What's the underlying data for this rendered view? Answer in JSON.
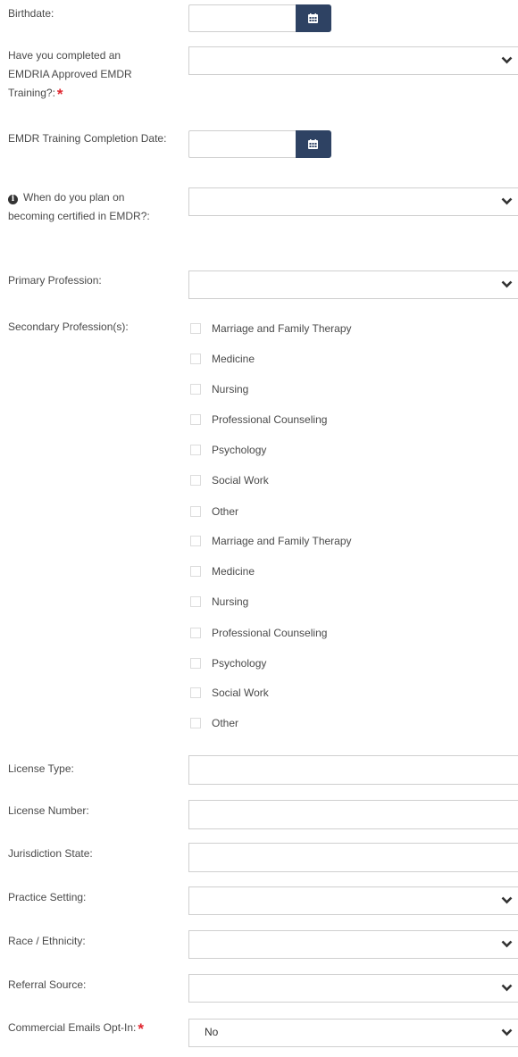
{
  "fields": {
    "birthdate": {
      "label": "Birthdate:"
    },
    "emdr_training": {
      "label": "Have you completed an EMDRIA Approved EMDR Training?:",
      "required_mark": "*",
      "value": ""
    },
    "training_completion": {
      "label": "EMDR Training Completion Date:"
    },
    "certified_plan": {
      "info_icon": "info-icon",
      "label": "When do you plan on becoming certified in EMDR?:",
      "value": ""
    },
    "primary_profession": {
      "label": "Primary Profession:",
      "value": ""
    },
    "secondary_profession": {
      "label": "Secondary Profession(s):",
      "options": [
        "Marriage and Family Therapy",
        "Medicine",
        "Nursing",
        "Professional Counseling",
        "Psychology",
        "Social Work",
        "Other",
        "Marriage and Family Therapy",
        "Medicine",
        "Nursing",
        "Professional Counseling",
        "Psychology",
        "Social Work",
        "Other"
      ]
    },
    "license_type": {
      "label": "License Type:",
      "value": ""
    },
    "license_number": {
      "label": "License Number:",
      "value": ""
    },
    "jurisdiction_state": {
      "label": "Jurisdiction State:",
      "value": ""
    },
    "practice_setting": {
      "label": "Practice Setting:",
      "value": ""
    },
    "race_ethnicity": {
      "label": "Race / Ethnicity:",
      "value": ""
    },
    "referral_source": {
      "label": "Referral Source:",
      "value": ""
    },
    "commercial_emails": {
      "label": "Commercial Emails Opt-In:",
      "required_mark": "*",
      "value": "No"
    }
  },
  "icons": {
    "calendar": "calendar-icon",
    "dropdown": "chevron-down-icon",
    "info": "info-icon"
  },
  "colors": {
    "calendar_button": "#2e4263",
    "required": "#e0262f",
    "border": "#cfcfcf"
  }
}
